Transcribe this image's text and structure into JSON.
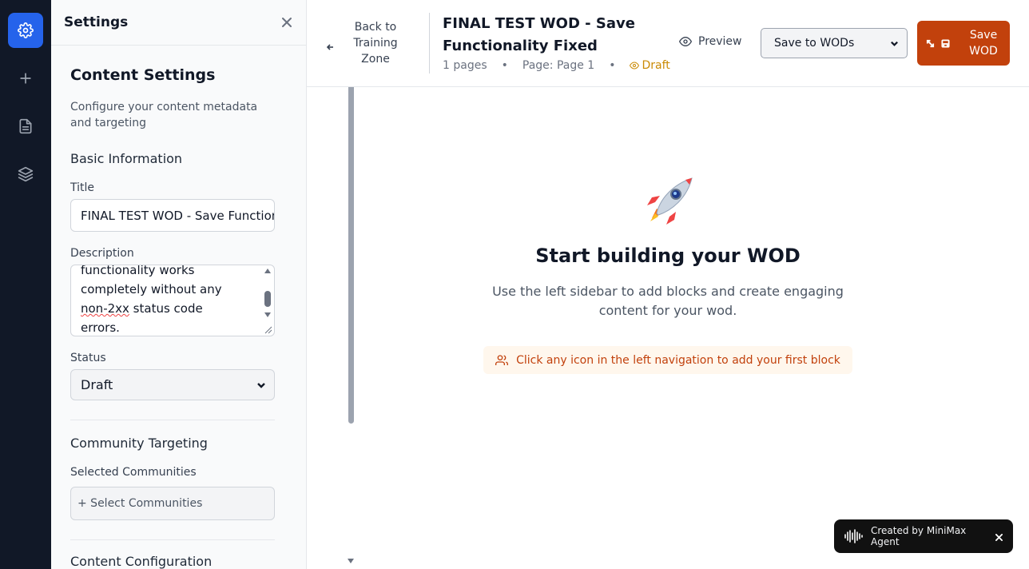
{
  "rail": {
    "items": [
      {
        "icon": "settings-icon",
        "active": true
      },
      {
        "icon": "plus-icon",
        "active": false
      },
      {
        "icon": "document-icon",
        "active": false
      },
      {
        "icon": "layers-icon",
        "active": false
      }
    ]
  },
  "settings_panel": {
    "title": "Settings",
    "content_settings_title": "Content Settings",
    "content_settings_desc": "Configure your content metadata and targeting",
    "basic_info_title": "Basic Information",
    "title_label": "Title",
    "title_value": "FINAL TEST WOD - Save Functionality Fixed",
    "description_label": "Description",
    "description_lines": [
      "functionality works",
      "completely without any",
      "non-2xx",
      " status code",
      "errors."
    ],
    "status_label": "Status",
    "status_value": "Draft",
    "community_title": "Community Targeting",
    "selected_communities_label": "Selected Communities",
    "select_communities_button": "+ Select Communities",
    "content_config_title": "Content Configuration"
  },
  "topbar": {
    "back_label": "Back to Training Zone",
    "doc_title": "FINAL TEST WOD - Save Functionality Fixed",
    "meta_pages": "1 pages",
    "meta_page": "Page: Page 1",
    "meta_status": "Draft",
    "preview_label": "Preview",
    "save_target": "Save to WODs",
    "save_button": "Save WOD"
  },
  "empty_state": {
    "title": "Start building your WOD",
    "description": "Use the left sidebar to add blocks and create engaging content for your wod.",
    "hint": "Click any icon in the left navigation to add your first block"
  },
  "toast": {
    "text": "Created by MiniMax Agent"
  },
  "colors": {
    "rail_bg": "#111827",
    "rail_active": "#2563eb",
    "accent_orange": "#c2410c",
    "draft_yellow": "#ca8a04"
  }
}
